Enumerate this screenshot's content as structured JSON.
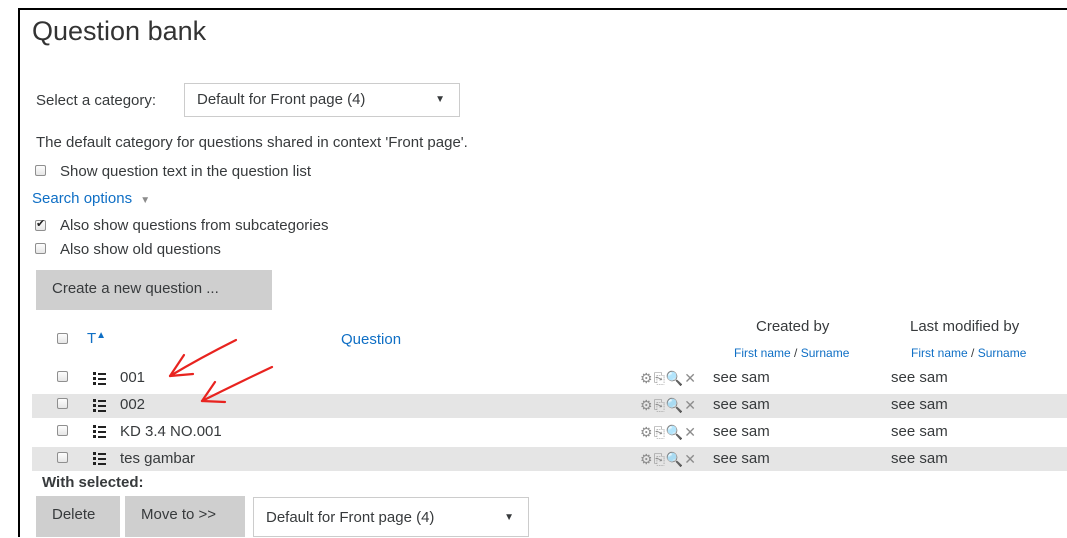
{
  "page_title": "Question bank",
  "category": {
    "label": "Select a category:",
    "selected": "Default for Front page (4)",
    "description": "The default category for questions shared in context 'Front page'."
  },
  "options": {
    "show_text": "Show question text in the question list",
    "search_options": "Search options",
    "subcategories": "Also show questions from subcategories",
    "old_questions": "Also show old questions"
  },
  "create_button": "Create a new question ...",
  "table": {
    "type_header": "T",
    "question_header": "Question",
    "created_by": "Created by",
    "last_modified_by": "Last modified by",
    "first_name": "First name",
    "slash": " / ",
    "surname": "Surname",
    "rows": [
      {
        "name": "001",
        "created": "see sam",
        "modified": "see sam"
      },
      {
        "name": "002",
        "created": "see sam",
        "modified": "see sam"
      },
      {
        "name": "KD 3.4 NO.001",
        "created": "see sam",
        "modified": "see sam"
      },
      {
        "name": "tes gambar",
        "created": "see sam",
        "modified": "see sam"
      }
    ]
  },
  "with_selected": "With selected:",
  "delete_button": "Delete",
  "move_button": "Move to >>",
  "move_target": "Default for Front page (4)",
  "colors": {
    "link": "#0f6fc5",
    "annotation": "#e8231f",
    "stripe": "#e5e5e5"
  }
}
